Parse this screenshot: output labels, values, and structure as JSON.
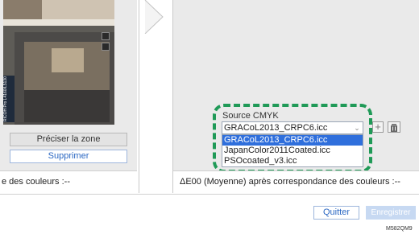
{
  "left_panel": {
    "photo_side_text": "RICOH Pro L4160/L5130",
    "preciser_label": "Préciser la zone",
    "supprimer_label": "Supprimer",
    "status_text": "e des couleurs :--"
  },
  "right_panel": {
    "source_label": "Source CMYK",
    "selected_value": "GRACoL2013_CRPC6.icc",
    "options": [
      "GRACoL2013_CRPC6.icc",
      "JapanColor2011Coated.icc",
      "PSOcoated_v3.icc"
    ],
    "status_text": "ΔE00 (Moyenne) après correspondance des couleurs :--"
  },
  "footer": {
    "quitter_label": "Quitter",
    "enregistrer_label": "Enregistrer",
    "figure_code": "M582QM9"
  },
  "colors": {
    "highlight": "#1f9a57",
    "selected_option": "#2f6fdc",
    "link_blue": "#2a67c3"
  },
  "icons": {
    "plus": "plus-icon",
    "trash": "trash-icon",
    "chevron": "chevron-down-icon"
  }
}
